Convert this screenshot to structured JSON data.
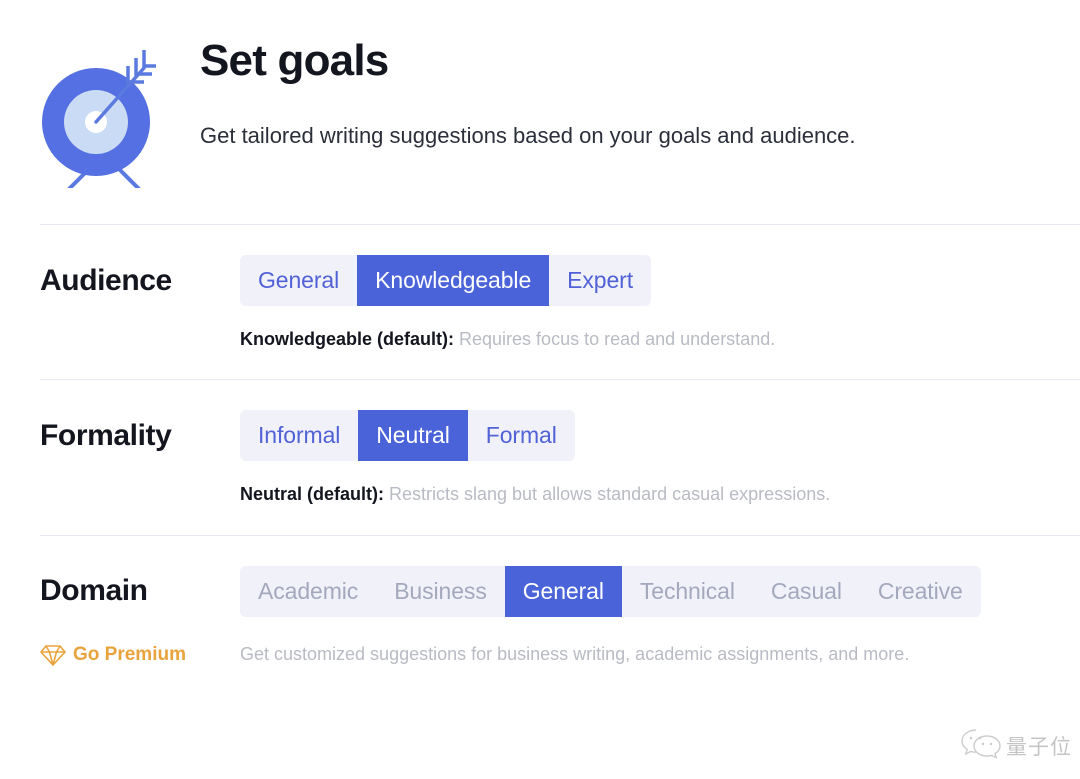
{
  "header": {
    "icon_name": "target-arrow-icon",
    "title": "Set goals",
    "subtitle": "Get tailored writing suggestions based on your goals and audience."
  },
  "colors": {
    "accent_selected": "#4a63d8",
    "segment_background": "#f1f2f9",
    "segment_text": "#5161d6",
    "disabled_text": "#a3a8bd",
    "premium_gold": "#e8a33d",
    "divider": "#e8e9f2"
  },
  "settings": [
    {
      "key": "audience",
      "label": "Audience",
      "options": [
        {
          "label": "General",
          "selected": false,
          "disabled": false
        },
        {
          "label": "Knowledgeable",
          "selected": true,
          "disabled": false
        },
        {
          "label": "Expert",
          "selected": false,
          "disabled": false
        }
      ],
      "description_lead": "Knowledgeable (default):",
      "description_rest": " Requires focus to read and understand."
    },
    {
      "key": "formality",
      "label": "Formality",
      "options": [
        {
          "label": "Informal",
          "selected": false,
          "disabled": false
        },
        {
          "label": "Neutral",
          "selected": true,
          "disabled": false
        },
        {
          "label": "Formal",
          "selected": false,
          "disabled": false
        }
      ],
      "description_lead": "Neutral (default):",
      "description_rest": " Restricts slang but allows standard casual expressions."
    },
    {
      "key": "domain",
      "label": "Domain",
      "options": [
        {
          "label": "Academic",
          "selected": false,
          "disabled": true
        },
        {
          "label": "Business",
          "selected": false,
          "disabled": true
        },
        {
          "label": "General",
          "selected": true,
          "disabled": false
        },
        {
          "label": "Technical",
          "selected": false,
          "disabled": true
        },
        {
          "label": "Casual",
          "selected": false,
          "disabled": true
        },
        {
          "label": "Creative",
          "selected": false,
          "disabled": true
        }
      ],
      "description_lead": "",
      "description_rest": ""
    }
  ],
  "premium": {
    "icon_name": "gem-icon",
    "link_label": "Go Premium",
    "description": "Get customized suggestions for business writing, academic assignments, and more."
  },
  "watermark": {
    "icon_name": "wechat-icon",
    "text": "量子位"
  }
}
